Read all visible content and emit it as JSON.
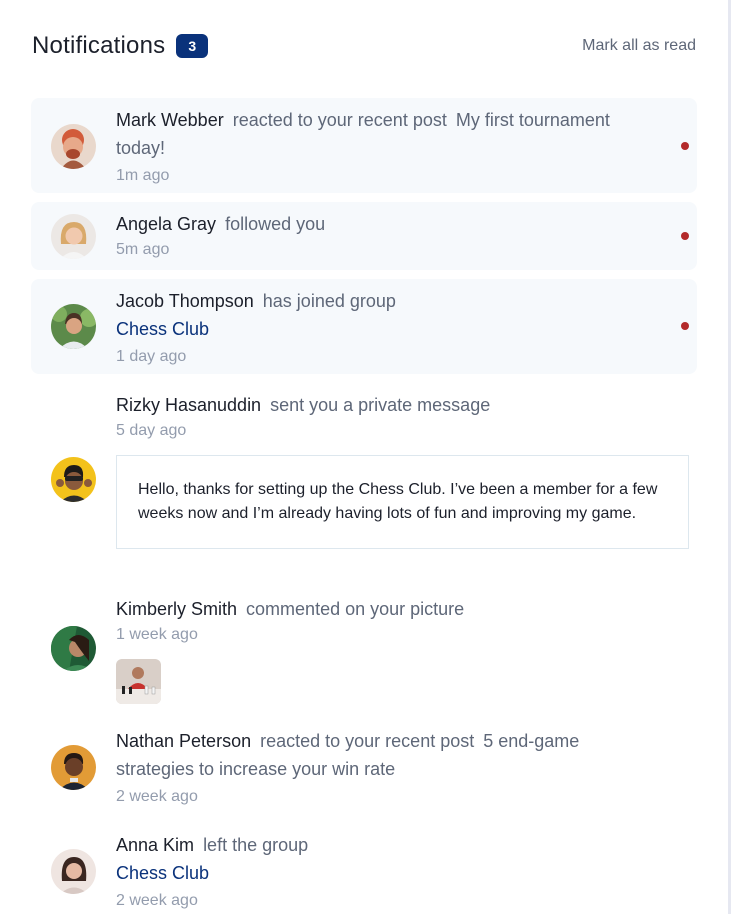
{
  "header": {
    "title": "Notifications",
    "unread_count": "3",
    "mark_all_label": "Mark all as read"
  },
  "notifications": [
    {
      "name": "Mark Webber",
      "action": "reacted to your recent post",
      "target": "My first tournament today!",
      "time": "1m ago",
      "unread": true
    },
    {
      "name": "Angela Gray",
      "action": "followed you",
      "time": "5m ago",
      "unread": true
    },
    {
      "name": "Jacob Thompson",
      "action": "has joined group",
      "group": "Chess Club",
      "time": "1 day ago",
      "unread": true
    },
    {
      "name": "Rizky Hasanuddin",
      "action": "sent you a private message",
      "time": "5 day ago",
      "message": "Hello, thanks for setting up the Chess Club. I’ve been a member for a few weeks now and I’m already having lots of fun and improving my game.",
      "unread": false
    },
    {
      "name": "Kimberly Smith",
      "action": "commented on your picture",
      "time": "1 week ago",
      "unread": false
    },
    {
      "name": "Nathan Peterson",
      "action": "reacted to your recent post",
      "target": "5 end-game strategies to increase your win rate",
      "time": "2 week ago",
      "unread": false
    },
    {
      "name": "Anna Kim",
      "action": "left the group",
      "group": "Chess Club",
      "time": "2 week ago",
      "unread": false
    }
  ],
  "colors": {
    "accent": "#0a327b",
    "unread_bg": "#f6f9fc",
    "unread_dot": "#b32a2a",
    "muted": "#5e6778",
    "time": "#939cad"
  }
}
